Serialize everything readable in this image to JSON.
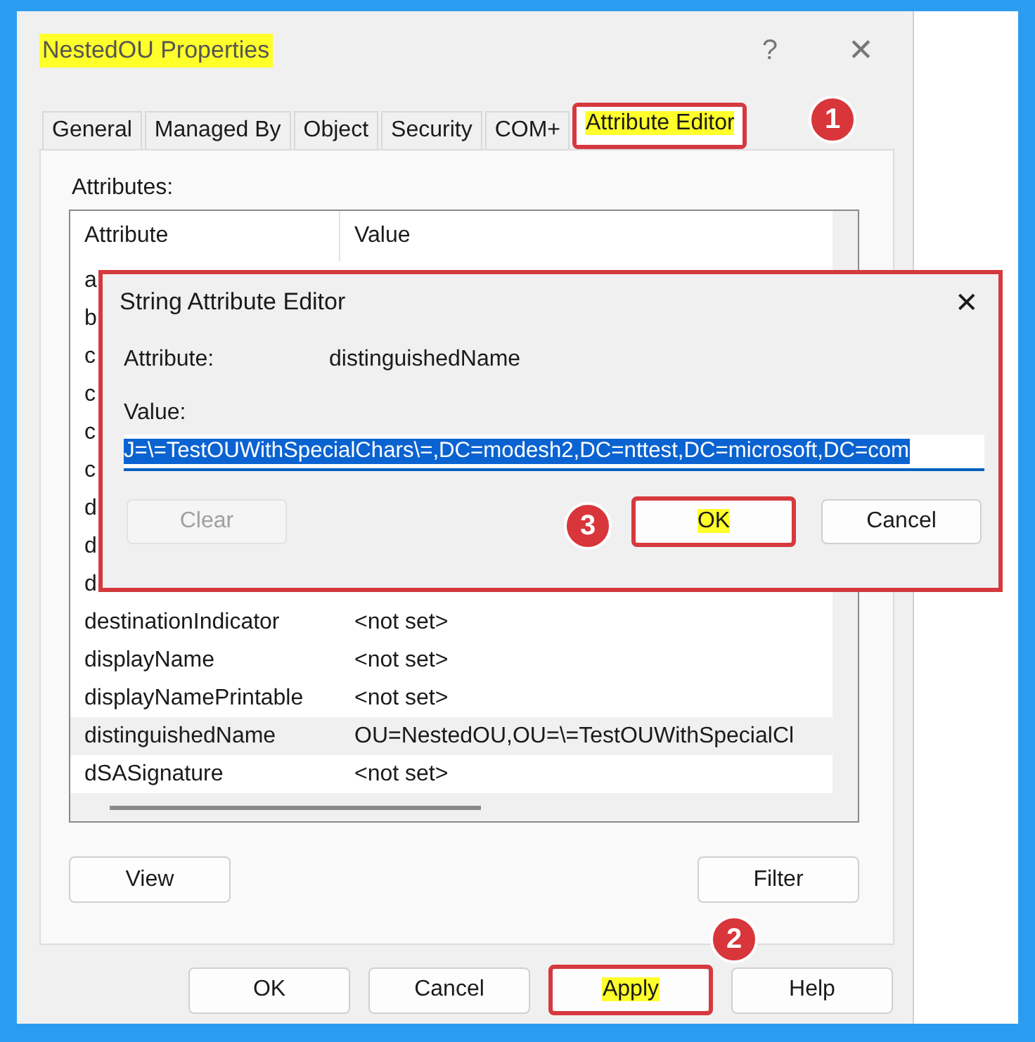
{
  "window": {
    "title": "NestedOU Properties",
    "title_highlighted": true,
    "help": "?",
    "close": "✕"
  },
  "tabs": [
    {
      "label": "General",
      "selected": false,
      "highlighted": false,
      "annotated": false
    },
    {
      "label": "Managed By",
      "selected": false,
      "highlighted": false,
      "annotated": false
    },
    {
      "label": "Object",
      "selected": false,
      "highlighted": false,
      "annotated": false
    },
    {
      "label": "Security",
      "selected": false,
      "highlighted": false,
      "annotated": false
    },
    {
      "label": "COM+",
      "selected": false,
      "highlighted": false,
      "annotated": false
    },
    {
      "label": "Attribute Editor",
      "selected": true,
      "highlighted": true,
      "annotated": true
    }
  ],
  "attributes_label": "Attributes:",
  "table": {
    "columns": [
      "Attribute",
      "Value"
    ],
    "rows": [
      {
        "attribute": "a",
        "selected": false
      },
      {
        "attribute": "b",
        "selected": false
      },
      {
        "attribute": "c",
        "selected": false
      },
      {
        "attribute": "c",
        "selected": false
      },
      {
        "attribute": "c",
        "selected": false
      },
      {
        "attribute": "c",
        "selected": false
      },
      {
        "attribute": "d",
        "selected": false
      },
      {
        "attribute": "d",
        "selected": false
      },
      {
        "attribute": "d",
        "selected": false
      },
      {
        "attribute": "destinationIndicator",
        "value": "<not set>",
        "selected": false
      },
      {
        "attribute": "displayName",
        "value": "<not set>",
        "selected": false
      },
      {
        "attribute": "displayNamePrintable",
        "value": "<not set>",
        "selected": false
      },
      {
        "attribute": "distinguishedName",
        "value": "OU=NestedOU,OU=\\=TestOUWithSpecialCl",
        "selected": true
      },
      {
        "attribute": "dSASignature",
        "value": "<not set>",
        "selected": false
      }
    ]
  },
  "list_buttons": [
    "View",
    "Filter"
  ],
  "buttons": [
    {
      "label": "OK",
      "highlighted": false,
      "annotated": false
    },
    {
      "label": "Cancel",
      "highlighted": false,
      "annotated": false
    },
    {
      "label": "Apply",
      "highlighted": true,
      "annotated": true
    },
    {
      "label": "Help",
      "highlighted": false,
      "annotated": false
    }
  ],
  "string_editor": {
    "title": "String Attribute Editor",
    "close": "✕",
    "annotated": true,
    "attribute_label": "Attribute:",
    "attribute": "distinguishedName",
    "value_label": "Value:",
    "value": "J=\\=TestOUWithSpecialChars\\=,DC=modesh2,DC=nttest,DC=microsoft,DC=com",
    "value_selected": true,
    "buttons": [
      {
        "label": "Clear",
        "disabled": true,
        "highlighted": false,
        "annotated": false
      },
      {
        "label": "OK",
        "disabled": false,
        "highlighted": true,
        "annotated": true
      },
      {
        "label": "Cancel",
        "disabled": false,
        "highlighted": false,
        "annotated": false
      }
    ]
  },
  "callouts": [
    {
      "text": "1"
    },
    {
      "text": "2"
    },
    {
      "text": "3"
    }
  ]
}
